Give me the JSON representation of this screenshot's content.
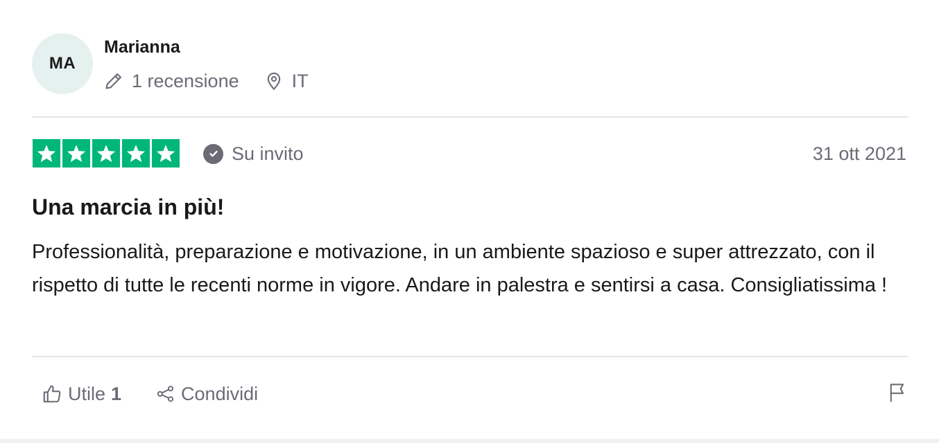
{
  "reviewer": {
    "initials": "MA",
    "name": "Marianna",
    "reviews_count": "1 recensione",
    "country": "IT"
  },
  "rating": {
    "stars": 5,
    "max_stars": 5,
    "star_color": "#00b67a"
  },
  "invited_label": "Su invito",
  "date": "31 ott 2021",
  "review": {
    "title": "Una marcia in più!",
    "body": "Professionalità, preparazione e motivazione, in un ambiente spazioso e super attrezzato, con il rispetto di tutte le recenti norme in vigore. Andare in palestra e sentirsi a casa. Consigliatissima !"
  },
  "actions": {
    "useful_label": "Utile",
    "useful_count": "1",
    "share_label": "Condividi"
  },
  "icons": {
    "pencil": "pencil-icon",
    "location": "location-pin-icon",
    "check": "check-circle-icon",
    "thumbs_up": "thumbs-up-icon",
    "share": "share-icon",
    "flag": "flag-icon",
    "star": "star-icon"
  },
  "colors": {
    "muted_text": "#6b6b76",
    "avatar_bg": "#e5f1ef"
  }
}
